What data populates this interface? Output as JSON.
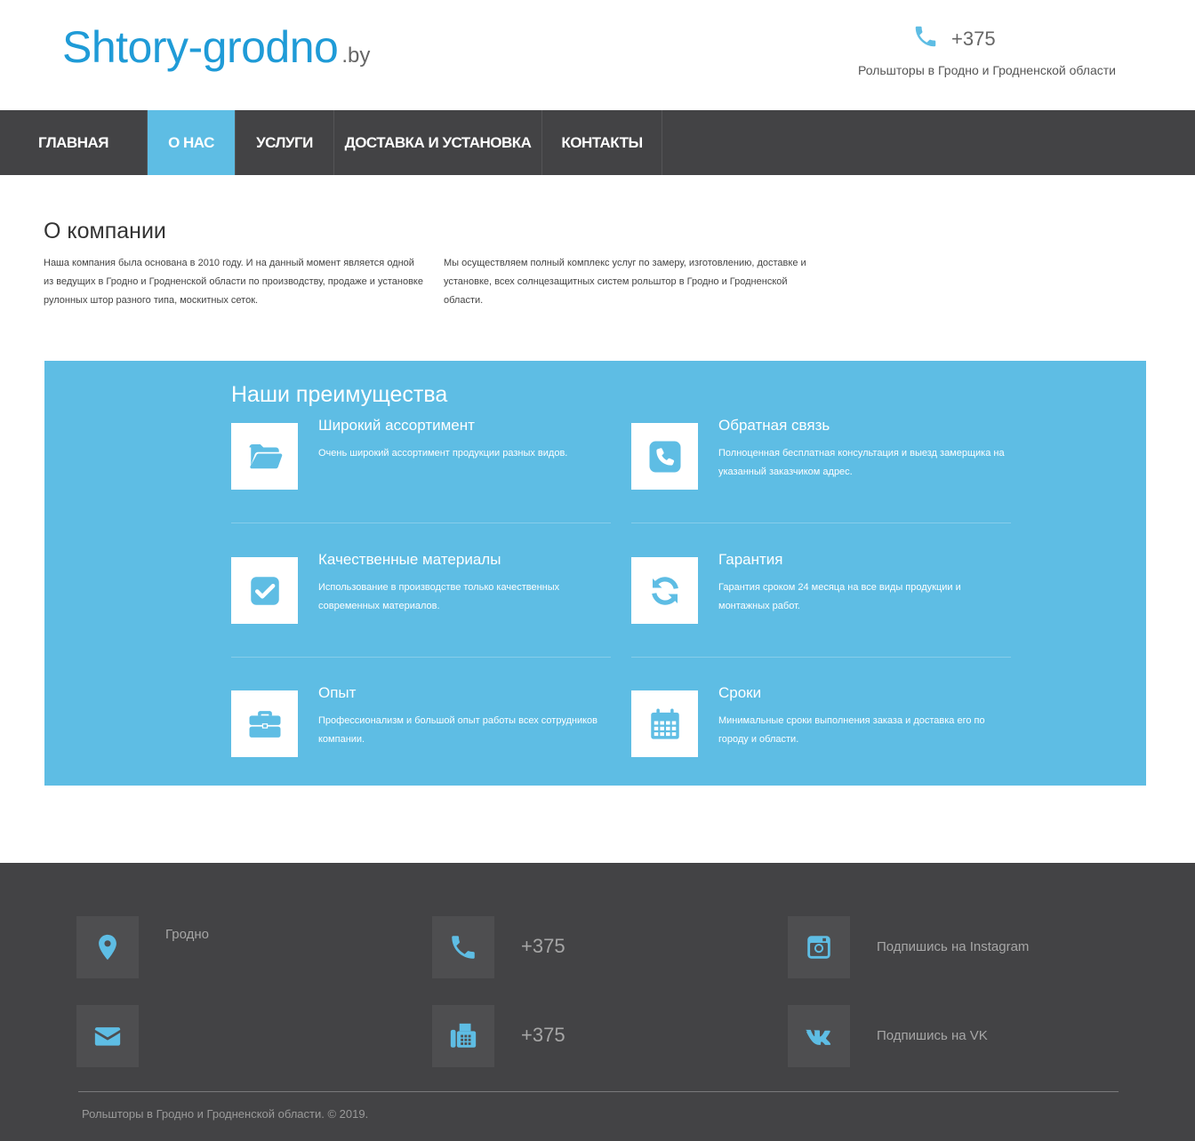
{
  "header": {
    "logo_main": "Shtory-grodno",
    "logo_suffix": ".by",
    "phone": "+375",
    "tagline": "Рольшторы в Гродно и Гродненской области"
  },
  "nav": {
    "items": [
      {
        "label": "ГЛАВНАЯ",
        "active": false
      },
      {
        "label": "О НАС",
        "active": true
      },
      {
        "label": "УСЛУГИ",
        "active": false
      },
      {
        "label": "ДОСТАВКА И УСТАНОВКА",
        "active": false
      },
      {
        "label": "КОНТАКТЫ",
        "active": false
      }
    ]
  },
  "about": {
    "title": "О компании",
    "col1": "Наша компания была основана в 2010 году. И на данный момент является одной из ведущих в Гродно и Гродненской области по производству, продаже и установке рулонных штор разного типа, москитных сеток.",
    "col2": "Мы осуществляем полный комплекс услуг по замеру, изготовлению, доставке и установке, всех солнцезащитных систем рольштор в Гродно и Гродненской области."
  },
  "advantages": {
    "title": "Наши преимущества",
    "items": [
      {
        "icon": "folder-open-icon",
        "name": "Широкий ассортимент",
        "desc": "Очень широкий ассортимент продукции разных видов."
      },
      {
        "icon": "phone-square-icon",
        "name": "Обратная связь",
        "desc": "Полноценная бесплатная консультация и выезд замерщика на указанный заказчиком адрес."
      },
      {
        "icon": "check-square-icon",
        "name": "Качественные материалы",
        "desc": "Использование в производстве только качественных современных материалов."
      },
      {
        "icon": "refresh-icon",
        "name": "Гарантия",
        "desc": "Гарантия сроком 24 месяца на все виды продукции и монтажных работ."
      },
      {
        "icon": "briefcase-icon",
        "name": "Опыт",
        "desc": "Профессионализм и большой опыт работы всех сотрудников компании."
      },
      {
        "icon": "calendar-icon",
        "name": "Сроки",
        "desc": "Минимальные сроки выполнения заказа и доставка его по городу и области."
      }
    ]
  },
  "footer": {
    "city": "Гродно",
    "phone1": "+375",
    "phone2": "+375",
    "instagram": "Подпишись на Instagram",
    "vk": "Подпишись на VK",
    "copyright": "Рольшторы в Гродно и Гродненской области. © 2019."
  },
  "colors": {
    "accent": "#5ebde4",
    "logo": "#1f9bd7",
    "dark": "#434345"
  }
}
